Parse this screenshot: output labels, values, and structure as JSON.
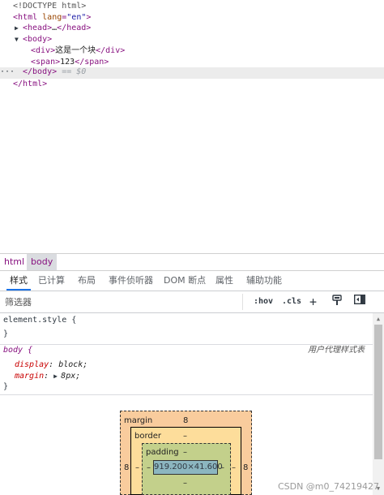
{
  "dom_tree": {
    "doctype": "<!DOCTYPE html>",
    "html_open": {
      "tag": "html",
      "attr_name": "lang",
      "attr_value": "\"en\""
    },
    "head": {
      "open": "<head>",
      "ellipsis": "…",
      "close": "</head>"
    },
    "body_open": "<body>",
    "div_line": {
      "open": "<div>",
      "text": "这是一个块",
      "close": "</div>"
    },
    "span_line": {
      "open": "<span>",
      "text": "123",
      "close": "</span>"
    },
    "body_close": "</body>",
    "selected_suffix": "== $0",
    "row_dots": "···",
    "html_close": "</html>"
  },
  "breadcrumb": [
    "html",
    "body"
  ],
  "tabs": [
    "样式",
    "已计算",
    "布局",
    "事件侦听器",
    "DOM 断点",
    "属性",
    "辅助功能"
  ],
  "filter": {
    "placeholder": "筛选器",
    "hov_label": ":hov",
    "cls_label": ".cls"
  },
  "styles": {
    "element_style": "element.style {",
    "close_brace": "}",
    "body_selector": "body {",
    "ua_label": "用户代理样式表",
    "props": [
      {
        "name": "display",
        "value": "block;"
      },
      {
        "name": "margin",
        "value": "8px;"
      }
    ]
  },
  "box_model": {
    "margin_label": "margin",
    "margin_top": "8",
    "margin_left": "8",
    "margin_right": "8",
    "border_label": "border",
    "border_value": "–",
    "padding_label": "padding",
    "padding_value": "–",
    "side_dash": "–",
    "content": "919.200×41.600"
  },
  "watermark": "CSDN @m0_74219427"
}
